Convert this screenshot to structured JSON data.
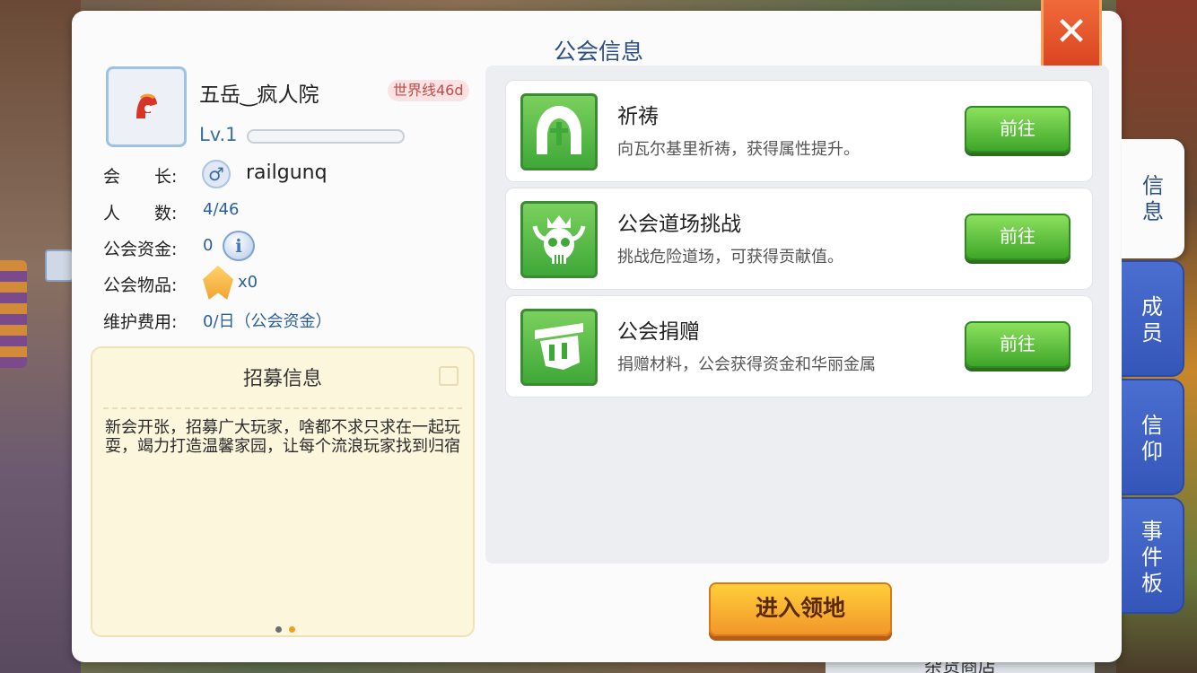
{
  "panel": {
    "title": "公会信息",
    "close_label": "✕"
  },
  "guild": {
    "name": "五岳‿疯人院",
    "world_badge": "世界线46d",
    "level": "Lv.1",
    "level_progress": 0.0
  },
  "info": {
    "leader_label": "会　　长:",
    "leader_name": "railgunq",
    "members_label": "人　　数:",
    "members_value": "4/46",
    "funds_label": "公会资金:",
    "funds_value": "0",
    "items_label": "公会物品:",
    "items_value": "x0",
    "upkeep_label": "维护费用:",
    "upkeep_value": "0/日（公会资金）"
  },
  "recruit": {
    "title": "招募信息",
    "text": "新会开张，招募广大玩家，啥都不求只求在一起玩耍，竭力打造温馨家园，让每个流浪玩家找到归宿",
    "dots": [
      "#6d6d6d",
      "#f0a020"
    ]
  },
  "activities": [
    {
      "title": "祈祷",
      "desc": "向瓦尔基里祈祷，获得属性提升。",
      "button": "前往",
      "icon": "pray-icon"
    },
    {
      "title": "公会道场挑战",
      "desc": "挑战危险道场，可获得贡献值。",
      "button": "前往",
      "icon": "skull-icon"
    },
    {
      "title": "公会捐赠",
      "desc": "捐赠材料，公会获得资金和华丽金属",
      "button": "前往",
      "icon": "donate-icon"
    }
  ],
  "enter_button": "进入领地",
  "tabs": [
    "信息",
    "成员",
    "信仰",
    "事件板"
  ],
  "active_tab": "信息",
  "background": {
    "shop_sign": "杂货商店"
  },
  "colors": {
    "title_blue": "#2c4f86",
    "green_button": "#3fa628",
    "orange_button": "#f2962a",
    "tab_blue": "#3456b8",
    "close_red": "#d8401e"
  }
}
